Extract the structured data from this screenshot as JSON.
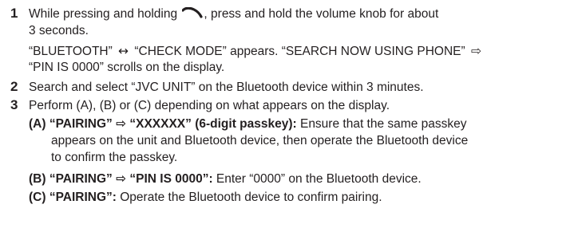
{
  "steps": [
    {
      "number": "1",
      "title_before_icon": "While pressing and holding ",
      "icon": "hang-up-icon",
      "title_after_icon": ", press and hold the volume knob for about",
      "title_line2": "3 seconds.",
      "detail": {
        "line1_a": "“BLUETOOTH” ",
        "line1_arrow1": "↔",
        "line1_b": " “CHECK MODE” appears. “SEARCH NOW USING PHONE” ",
        "line1_arrow2": "⇨",
        "line2": "“PIN IS 0000” scrolls on the display."
      }
    },
    {
      "number": "2",
      "title": "Search and select “JVC UNIT” on the Bluetooth device within 3 minutes."
    },
    {
      "number": "3",
      "title": "Perform (A), (B) or (C) depending on what appears on the display.",
      "options": [
        {
          "label_bold": "(A) “PAIRING” ⇨ “XXXXXX” (6-digit passkey):",
          "text_line1": " Ensure that the same passkey",
          "text_line2": "appears on the unit and Bluetooth device, then operate the Bluetooth device",
          "text_line3": "to confirm the passkey."
        },
        {
          "label_bold": "(B) “PAIRING” ⇨ “PIN IS 0000”:",
          "text": " Enter “0000” on the Bluetooth device."
        },
        {
          "label_bold": "(C) “PAIRING”:",
          "text": " Operate the Bluetooth device to confirm pairing."
        }
      ]
    }
  ]
}
